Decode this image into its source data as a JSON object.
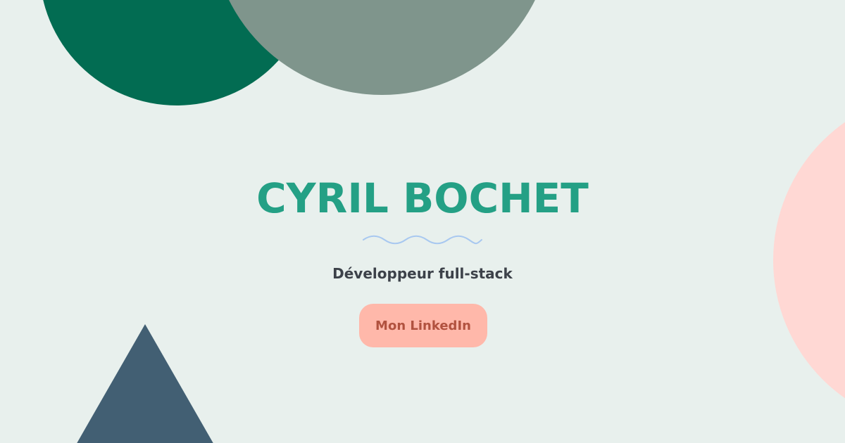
{
  "hero": {
    "name": "CYRIL BOCHET",
    "subtitle": "Développeur full-stack",
    "cta_label": "Mon LinkedIn"
  },
  "decorations": {
    "divider": "wave-divider-icon",
    "shapes": [
      "green-circle",
      "sage-circle",
      "pink-circle",
      "slate-triangle"
    ]
  },
  "colors": {
    "background": "#e8f0ed",
    "title": "#24a085",
    "subtitle": "#3c4149",
    "wave": "#a8c8f0",
    "cta_background": "#ffb8aa",
    "cta_text": "#b1523f",
    "circle_green": "#026c52",
    "circle_sage": "#7f958c",
    "circle_pink": "#ffd8d4",
    "triangle_slate": "#425f73"
  }
}
